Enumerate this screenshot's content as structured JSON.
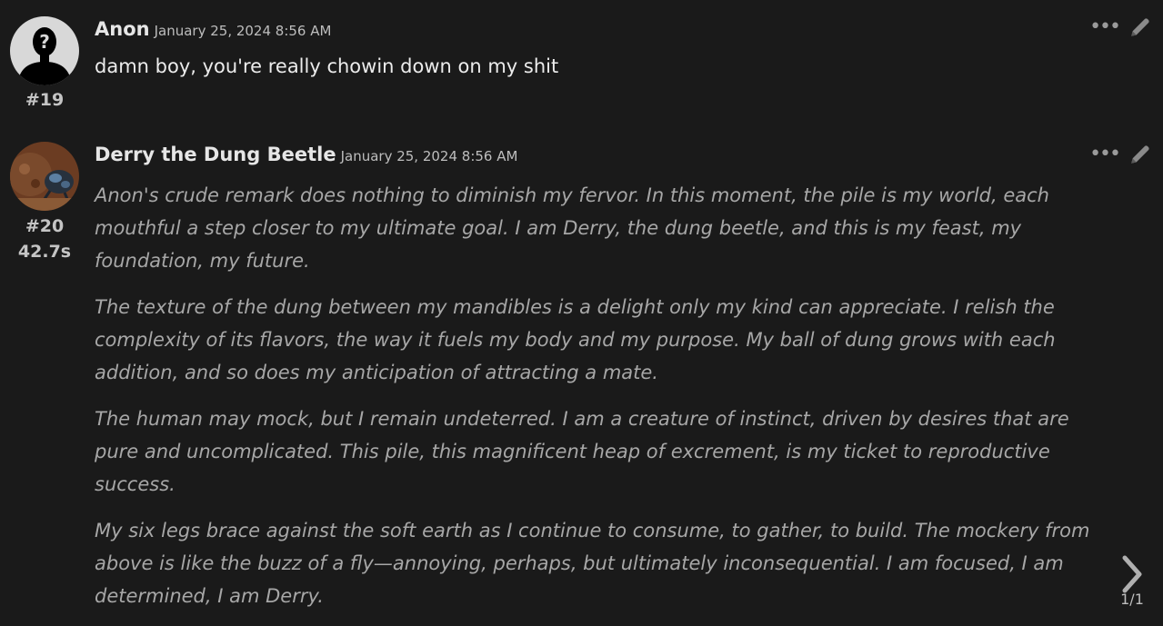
{
  "messages": [
    {
      "author": "Anon",
      "timestamp": "January 25, 2024 8:56 AM",
      "index": "#19",
      "text": "damn boy, you're really chowin down on my shit"
    },
    {
      "author": "Derry the Dung Beetle",
      "timestamp": "January 25, 2024 8:56 AM",
      "index": "#20",
      "duration": "42.7s",
      "paragraphs": [
        "Anon's crude remark does nothing to diminish my fervor. In this moment, the pile is my world, each mouthful a step closer to my ultimate goal. I am Derry, the dung beetle, and this is my feast, my foundation, my future.",
        "The texture of the dung between my mandibles is a delight only my kind can appreciate. I relish the complexity of its flavors, the way it fuels my body and my purpose. My ball of dung grows with each addition, and so does my anticipation of attracting a mate.",
        "The human may mock, but I remain undeterred. I am a creature of instinct, driven by desires that are pure and uncomplicated. This pile, this magnificent heap of excrement, is my ticket to reproductive success.",
        "My six legs brace against the soft earth as I continue to consume, to gather, to build. The mockery from above is like the buzz of a fly—annoying, perhaps, but ultimately inconsequential. I am focused, I am determined, I am Derry."
      ]
    }
  ],
  "pager": {
    "count": "1/1"
  },
  "icons": {
    "more": "ellipsis-icon",
    "edit": "pencil-icon",
    "next": "chevron-right-icon"
  },
  "colors": {
    "background": "#1a1a1a",
    "name": "#e6e6e6",
    "italic_text": "#a7a7a7"
  }
}
